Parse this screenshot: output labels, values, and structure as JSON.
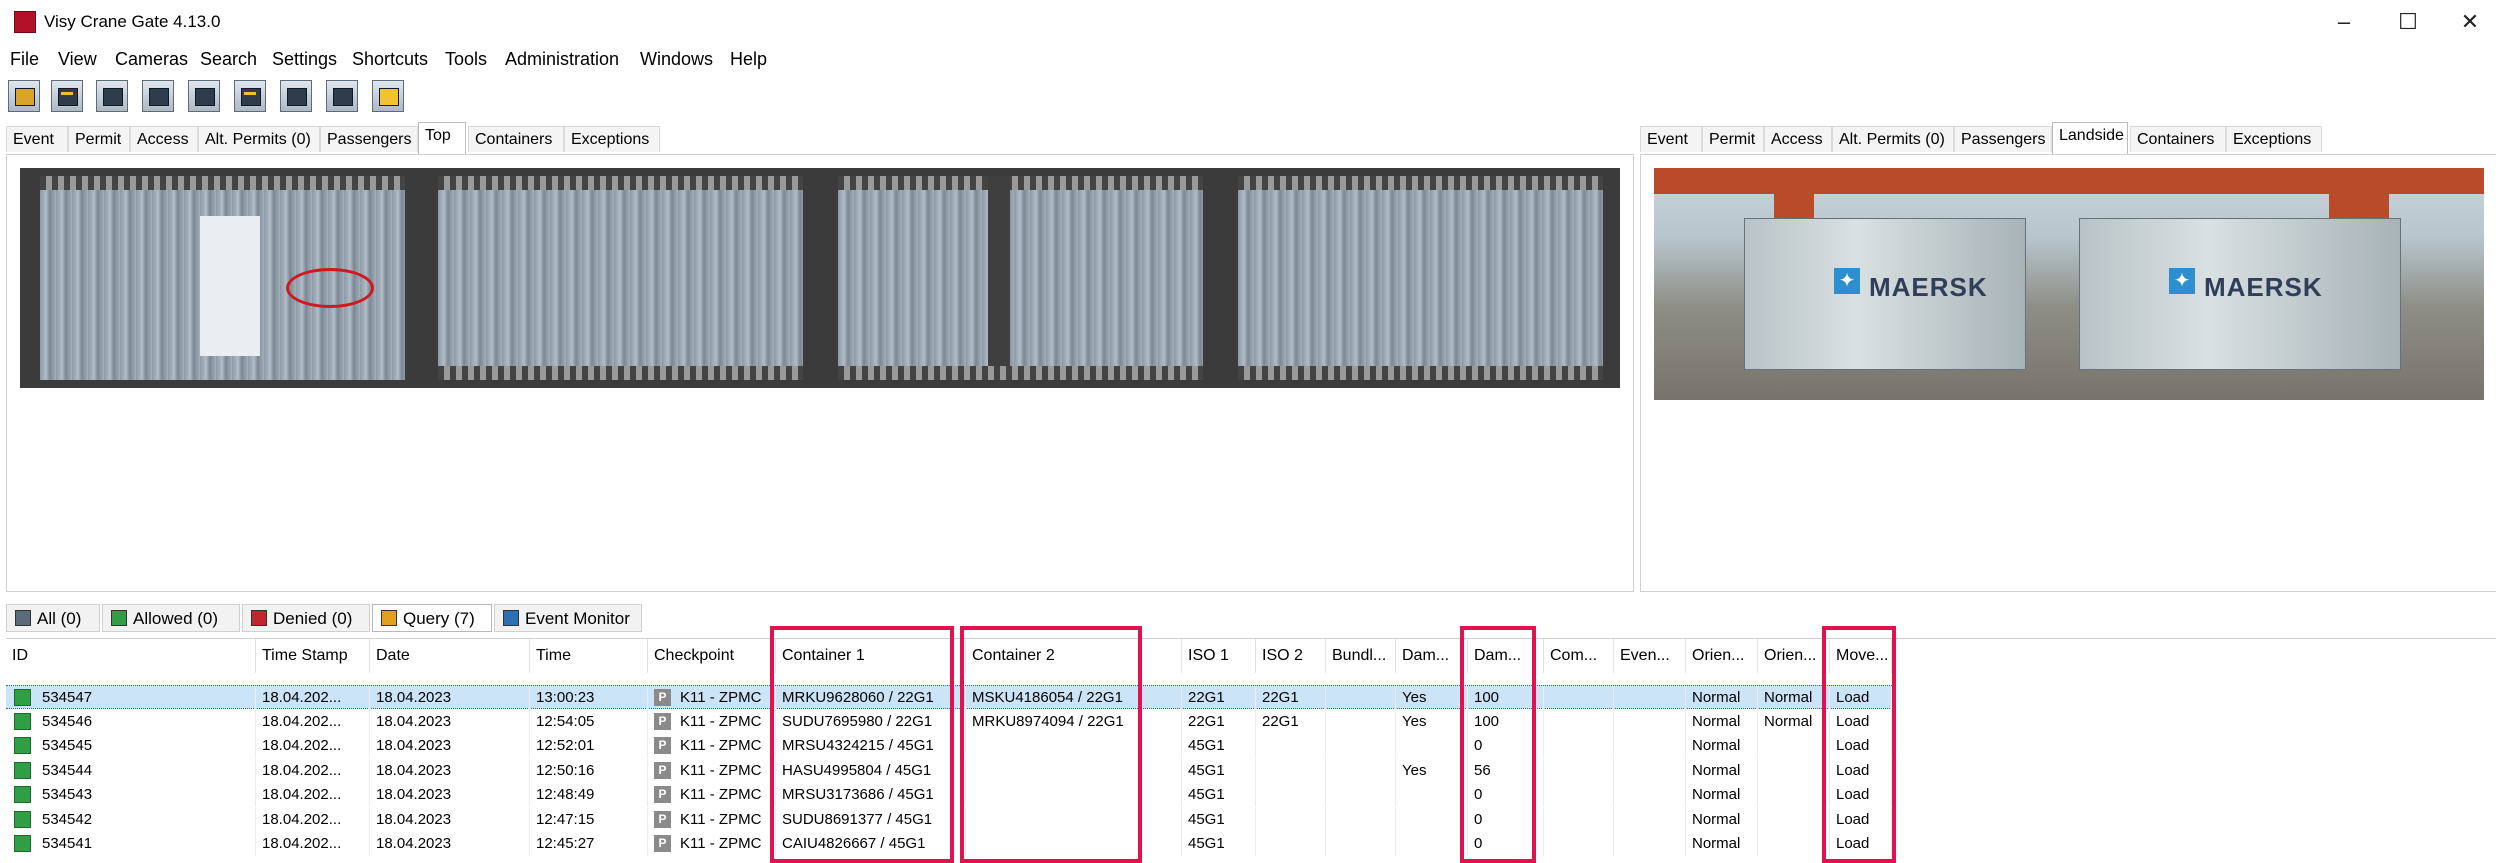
{
  "window": {
    "title": "Visy Crane Gate 4.13.0"
  },
  "menu": [
    "File",
    "View",
    "Cameras",
    "Search",
    "Settings",
    "Shortcuts",
    "Tools",
    "Administration",
    "Windows",
    "Help"
  ],
  "left_tabs": [
    "Event",
    "Permit",
    "Access",
    "Alt. Permits (0)",
    "Passengers",
    "Top",
    "Containers",
    "Exceptions"
  ],
  "right_tabs": [
    "Event",
    "Permit",
    "Access",
    "Alt. Permits (0)",
    "Passengers",
    "Landside",
    "Containers",
    "Exceptions"
  ],
  "landside_text": [
    "MAERSK",
    "MAERSK"
  ],
  "bottom_tabs": [
    {
      "label": "All  (0)",
      "color": "#5b6b7a"
    },
    {
      "label": "Allowed (0)",
      "color": "#2f9e44"
    },
    {
      "label": "Denied (0)",
      "color": "#c0262d"
    },
    {
      "label": "Query (7)",
      "color": "#e0a020"
    },
    {
      "label": "Event Monitor",
      "color": "#2d6fb5"
    }
  ],
  "grid": {
    "columns": [
      "ID",
      "Time Stamp",
      "Date",
      "Time",
      "Checkpoint",
      "Container 1",
      "Container 2",
      "ISO 1",
      "ISO 2",
      "Bundl...",
      "Dam...",
      "Dam...",
      "Com...",
      "Even...",
      "Orien...",
      "Orien...",
      "Move..."
    ],
    "rows": [
      [
        "534547",
        "18.04.202...",
        "18.04.2023",
        "13:00:23",
        "K11 - ZPMC",
        "MRKU9628060 / 22G1",
        "MSKU4186054 / 22G1",
        "22G1",
        "22G1",
        "",
        "Yes",
        "100",
        "",
        "",
        "Normal",
        "Normal",
        "Load"
      ],
      [
        "534546",
        "18.04.202...",
        "18.04.2023",
        "12:54:05",
        "K11 - ZPMC",
        "SUDU7695980 / 22G1",
        "MRKU8974094 / 22G1",
        "22G1",
        "22G1",
        "",
        "Yes",
        "100",
        "",
        "",
        "Normal",
        "Normal",
        "Load"
      ],
      [
        "534545",
        "18.04.202...",
        "18.04.2023",
        "12:52:01",
        "K11 - ZPMC",
        "MRSU4324215 / 45G1",
        "",
        "45G1",
        "",
        "",
        "",
        "0",
        "",
        "",
        "Normal",
        "",
        "Load"
      ],
      [
        "534544",
        "18.04.202...",
        "18.04.2023",
        "12:50:16",
        "K11 - ZPMC",
        "HASU4995804 / 45G1",
        "",
        "45G1",
        "",
        "",
        "Yes",
        "56",
        "",
        "",
        "Normal",
        "",
        "Load"
      ],
      [
        "534543",
        "18.04.202...",
        "18.04.2023",
        "12:48:49",
        "K11 - ZPMC",
        "MRSU3173686 / 45G1",
        "",
        "45G1",
        "",
        "",
        "",
        "0",
        "",
        "",
        "Normal",
        "",
        "Load"
      ],
      [
        "534542",
        "18.04.202...",
        "18.04.2023",
        "12:47:15",
        "K11 - ZPMC",
        "SUDU8691377 / 45G1",
        "",
        "45G1",
        "",
        "",
        "",
        "0",
        "",
        "",
        "Normal",
        "",
        "Load"
      ],
      [
        "534541",
        "18.04.202...",
        "18.04.2023",
        "12:45:27",
        "K11 - ZPMC",
        "CAIU4826667 / 45G1",
        "",
        "45G1",
        "",
        "",
        "",
        "0",
        "",
        "",
        "Normal",
        "",
        "Load"
      ]
    ]
  },
  "checkpoint_icon": "P",
  "colors": {
    "highlight": "#e3124f",
    "status_allowed": "#2f9e44",
    "selection": "#cce4f7"
  }
}
